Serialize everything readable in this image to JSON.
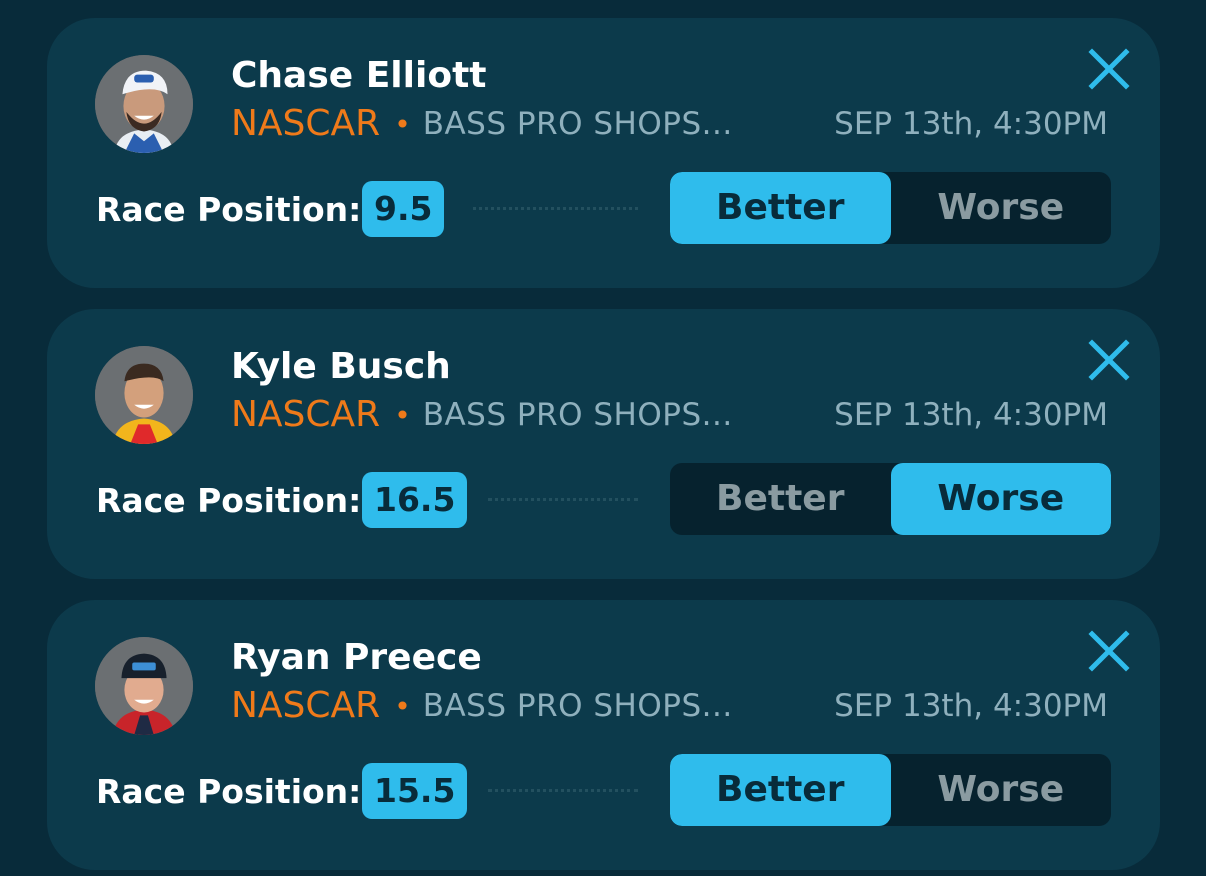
{
  "colors": {
    "background": "#082b3a",
    "card": "#0c3a4b",
    "accent": "#2fbcec",
    "league": "#ef7a1a",
    "muted": "#8fb0bd"
  },
  "picks": [
    {
      "player_name": "Chase Elliott",
      "league": "NASCAR",
      "separator": "•",
      "event": "BASS PRO SHOPS...",
      "datetime": "SEP 13th, 4:30PM",
      "stat_label": "Race Position:",
      "stat_value": "9.5",
      "better_label": "Better",
      "worse_label": "Worse",
      "selected": "Better",
      "avatar_icon": "driver-photo",
      "close_icon": "close-icon"
    },
    {
      "player_name": "Kyle Busch",
      "league": "NASCAR",
      "separator": "•",
      "event": "BASS PRO SHOPS...",
      "datetime": "SEP 13th, 4:30PM",
      "stat_label": "Race Position:",
      "stat_value": "16.5",
      "better_label": "Better",
      "worse_label": "Worse",
      "selected": "Worse",
      "avatar_icon": "driver-photo",
      "close_icon": "close-icon"
    },
    {
      "player_name": "Ryan Preece",
      "league": "NASCAR",
      "separator": "•",
      "event": "BASS PRO SHOPS...",
      "datetime": "SEP 13th, 4:30PM",
      "stat_label": "Race Position:",
      "stat_value": "15.5",
      "better_label": "Better",
      "worse_label": "Worse",
      "selected": "Better",
      "avatar_icon": "driver-photo",
      "close_icon": "close-icon"
    }
  ]
}
